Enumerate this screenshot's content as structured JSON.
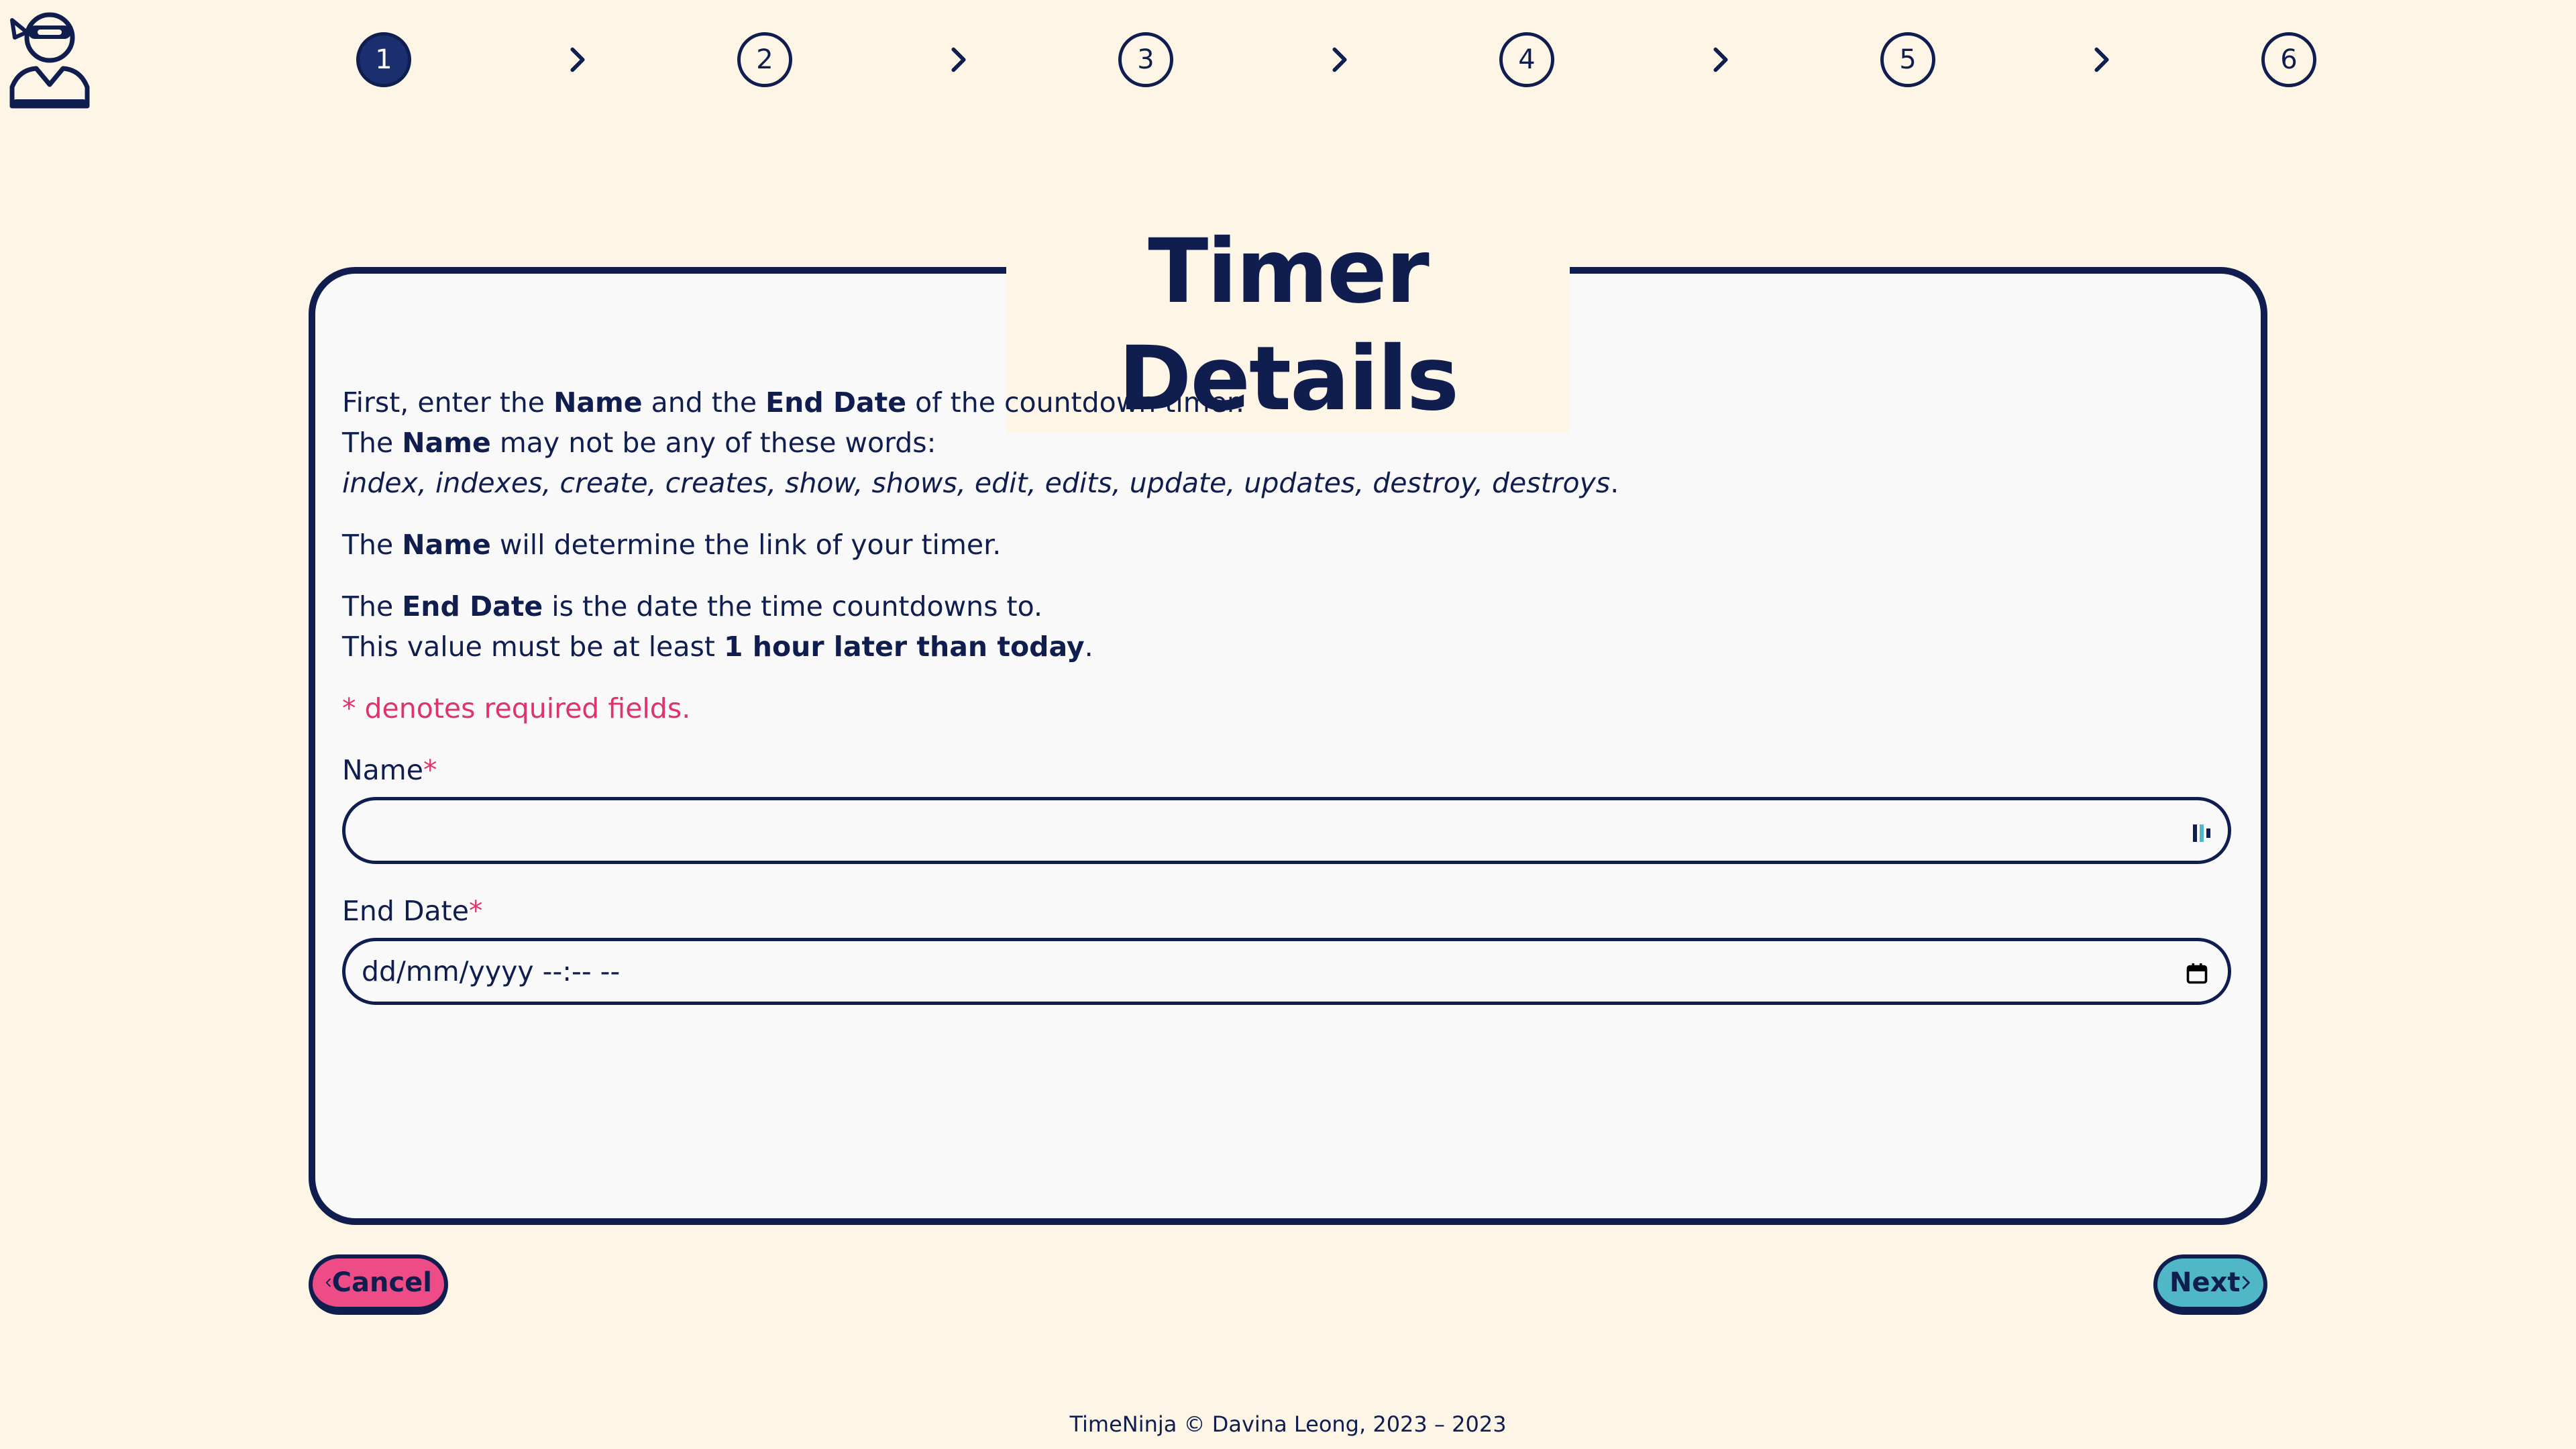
{
  "app": {
    "title": "Timer Details",
    "colors": {
      "primary": "#0f1d4f",
      "accent_pink": "#ed4c86",
      "accent_teal": "#4fb7c6",
      "required": "#e0336b",
      "background": "#fdf6e6"
    },
    "logo_icon": "ninja-avatar-icon"
  },
  "stepper": {
    "steps": [
      "1",
      "2",
      "3",
      "4",
      "5",
      "6"
    ],
    "active_step": "1",
    "separator_icon": "chevron-right-icon"
  },
  "instructions": {
    "p1_a": "First, enter the ",
    "p1_name": "Name",
    "p1_b": " and the ",
    "p1_enddate": "End Date",
    "p1_c": " of the countdown timer.",
    "p2_a": "The ",
    "p2_name": "Name",
    "p2_b": " may not be any of these words:",
    "reserved_words": "index, indexes, create, creates, show, shows, edit, edits, update, updates, destroy, destroys",
    "reserved_end": ".",
    "p3_a": "The ",
    "p3_name": "Name",
    "p3_b": " will determine the link of your timer.",
    "p4_a": "The ",
    "p4_enddate": "End Date",
    "p4_b": " is the date the time countdowns to.",
    "p5_a": "This value must be at least ",
    "p5_bold": "1 hour later than today",
    "p5_b": ".",
    "required_note": "* denotes required fields."
  },
  "form": {
    "name_label": "Name",
    "name_value": "",
    "end_date_label": "End Date",
    "end_date_placeholder": "dd/mm/yyyy --:-- --",
    "required_mark": "*"
  },
  "buttons": {
    "cancel_label": "Cancel",
    "next_label": "Next"
  },
  "footer": {
    "text": "TimeNinja © Davina Leong, 2023 – 2023"
  }
}
